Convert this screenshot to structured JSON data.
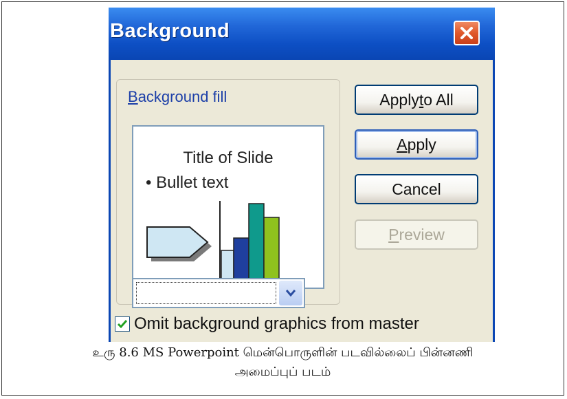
{
  "dialog": {
    "title": "Background",
    "group": {
      "label_pre": "",
      "label_accel": "B",
      "label_post": "ackground fill"
    },
    "preview": {
      "slide_title": "Title of Slide",
      "bullet_text": "• Bullet text"
    },
    "fill_dropdown": {
      "selected": ""
    },
    "buttons": {
      "apply_to_all": {
        "pre": "Apply ",
        "accel": "t",
        "post": "o All"
      },
      "apply": {
        "pre": "",
        "accel": "A",
        "post": "pply"
      },
      "cancel": "Cancel",
      "preview": {
        "pre": "",
        "accel": "P",
        "post": "review"
      }
    },
    "omit_checkbox": {
      "checked": true,
      "label_pre": "Omit background ",
      "label_accel": "g",
      "label_post": "raphics from master"
    }
  },
  "caption": {
    "line1": "உரு 8.6 MS Powerpoint மென்பொருளின் படவில்லைப் பின்னணி",
    "line2": "அமைப்புப் படம்"
  },
  "colors": {
    "titlebar": "#0a46b4",
    "close_button": "#e0582b",
    "chart_bar_1": "#cfe7f3",
    "chart_bar_2": "#1f3f9e",
    "chart_bar_3": "#0f9a8c",
    "chart_bar_4": "#8fc21e",
    "arrow_shape": "#cfe7f3"
  }
}
